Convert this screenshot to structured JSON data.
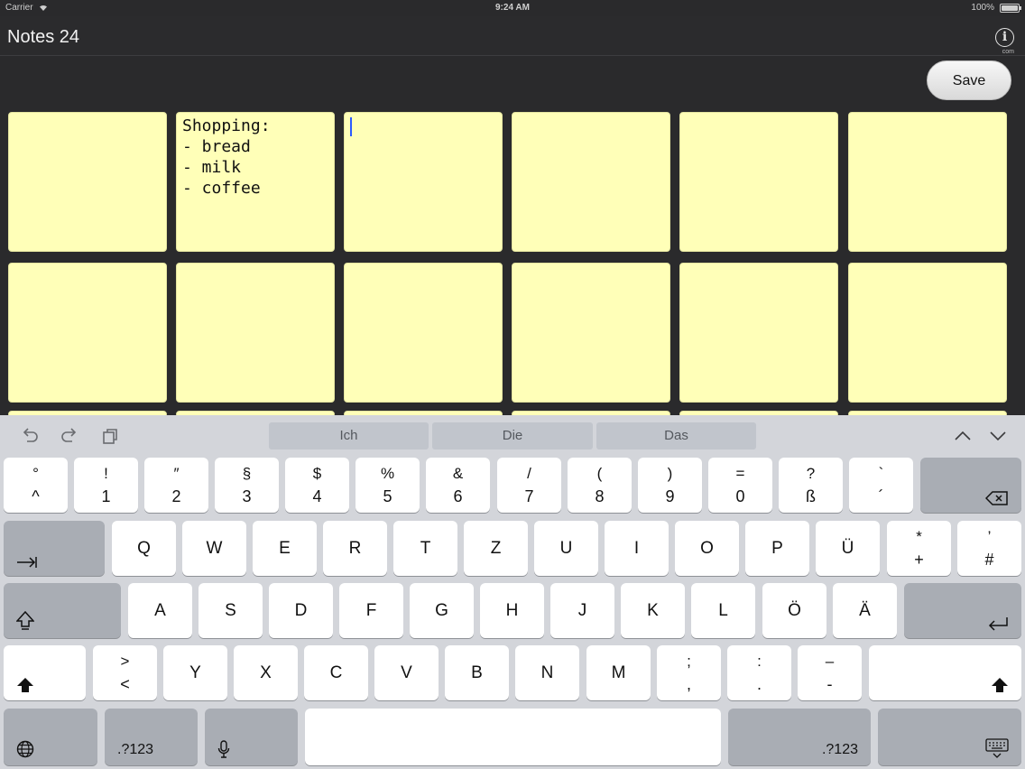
{
  "status": {
    "carrier": "Carrier",
    "time": "9:24 AM",
    "battery": "100%"
  },
  "nav": {
    "title": "Notes 24",
    "info_sub": "com"
  },
  "toolbar": {
    "save_label": "Save"
  },
  "notes": [
    {
      "text": ""
    },
    {
      "text": "Shopping:\n- bread\n- milk\n- coffee"
    },
    {
      "text": ""
    },
    {
      "text": ""
    },
    {
      "text": ""
    },
    {
      "text": ""
    },
    {
      "text": ""
    },
    {
      "text": ""
    },
    {
      "text": ""
    },
    {
      "text": ""
    },
    {
      "text": ""
    },
    {
      "text": ""
    }
  ],
  "keyboard": {
    "suggestions": [
      "Ich",
      "Die",
      "Das"
    ],
    "row1": [
      {
        "top": "°",
        "bottom": "^"
      },
      {
        "top": "!",
        "bottom": "1"
      },
      {
        "top": "″",
        "bottom": "2"
      },
      {
        "top": "§",
        "bottom": "3"
      },
      {
        "top": "$",
        "bottom": "4"
      },
      {
        "top": "%",
        "bottom": "5"
      },
      {
        "top": "&",
        "bottom": "6"
      },
      {
        "top": "/",
        "bottom": "7"
      },
      {
        "top": "(",
        "bottom": "8"
      },
      {
        "top": ")",
        "bottom": "9"
      },
      {
        "top": "=",
        "bottom": "0"
      },
      {
        "top": "?",
        "bottom": "ß"
      },
      {
        "top": "`",
        "bottom": "´"
      }
    ],
    "row2": [
      "Q",
      "W",
      "E",
      "R",
      "T",
      "Z",
      "U",
      "I",
      "O",
      "P",
      "Ü"
    ],
    "row2_extra": [
      {
        "top": "*",
        "bottom": "+"
      },
      {
        "top": "’",
        "bottom": "#"
      }
    ],
    "row3": [
      "A",
      "S",
      "D",
      "F",
      "G",
      "H",
      "J",
      "K",
      "L",
      "Ö",
      "Ä"
    ],
    "row4_angle": {
      "top": ">",
      "bottom": "<"
    },
    "row4": [
      "Y",
      "X",
      "C",
      "V",
      "B",
      "N",
      "M"
    ],
    "row4_extra": [
      {
        "top": ";",
        "bottom": ","
      },
      {
        "top": ":",
        "bottom": "."
      },
      {
        "top": "–",
        "bottom": "-"
      }
    ],
    "numbers_label": ".?123"
  },
  "icons": {
    "undo": "undo-icon",
    "redo": "redo-icon",
    "paste": "paste-icon",
    "delete": "delete-icon",
    "tab": "tab-icon",
    "caps": "caps-lock-icon",
    "return": "return-icon",
    "shift": "shift-icon",
    "globe": "globe-icon",
    "mic": "microphone-icon",
    "hide": "keyboard-hide-icon"
  }
}
